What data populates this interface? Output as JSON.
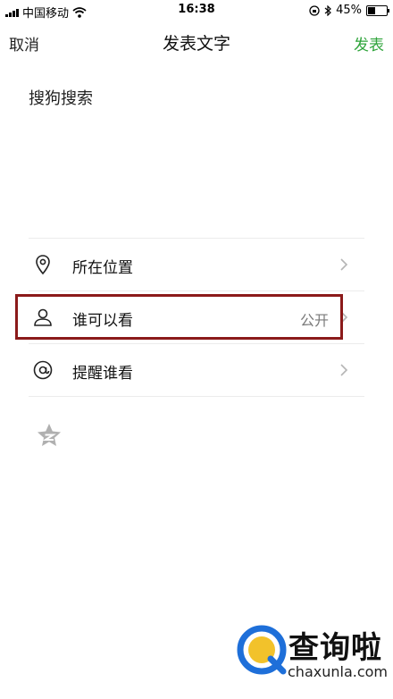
{
  "status_bar": {
    "carrier": "中国移动",
    "time": "16:38",
    "battery": "45%",
    "battery_level": 0.45
  },
  "nav": {
    "cancel_label": "取消",
    "title": "发表文字",
    "post_label": "发表",
    "post_color": "#2fa43b"
  },
  "compose": {
    "text": "搜狗搜索"
  },
  "options": [
    {
      "label": "所在位置",
      "icon": "location-pin-icon",
      "value": ""
    },
    {
      "label": "谁可以看",
      "icon": "person-icon",
      "value": "公开"
    },
    {
      "label": "提醒谁看",
      "icon": "at-sign-icon",
      "value": ""
    }
  ],
  "highlight_color": "#8b1a1a",
  "watermark": {
    "name": "查询啦",
    "url": "chaxunla.com"
  }
}
